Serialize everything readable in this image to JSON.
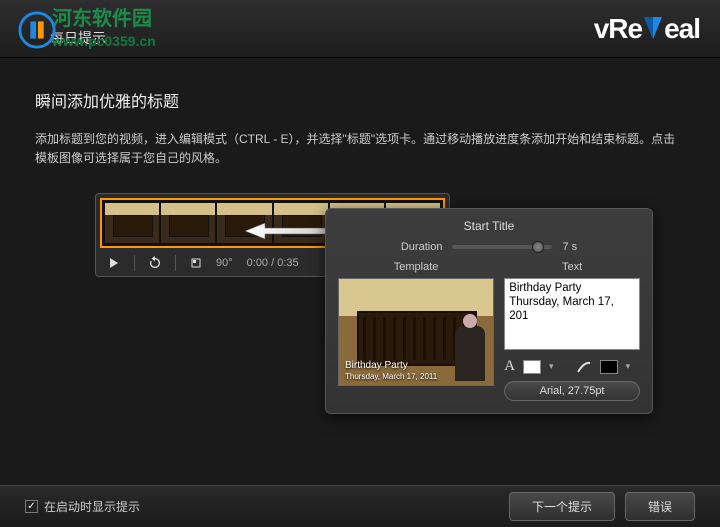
{
  "watermark": {
    "site": "河东软件园",
    "url": "www.pc0359.cn"
  },
  "header": {
    "daily_tip": "每日提示",
    "brand": "vReVeal"
  },
  "page": {
    "title": "瞬间添加优雅的标题",
    "desc": "添加标题到您的视频，进入编辑模式（CTRL - E），并选择\"标题\"选项卡。通过移动播放进度条添加开始和结束标题。点击模板图像可选择属于您自己的风格。"
  },
  "timeline": {
    "rotation": "90°",
    "time": "0:00 / 0:35"
  },
  "panel": {
    "title": "Start Title",
    "duration_label": "Duration",
    "duration_value": "7 s",
    "template_label": "Template",
    "text_label": "Text",
    "preview_line1": "Birthday Party",
    "preview_line2": "Thursday, March 17, 2011",
    "text_line1": "Birthday Party",
    "text_line2": "Thursday, March 17, 201",
    "font_button": "Arial, 27.75pt"
  },
  "footer": {
    "checkbox_label": "在启动时显示提示",
    "next_btn": "下一个提示",
    "error_btn": "错误"
  }
}
